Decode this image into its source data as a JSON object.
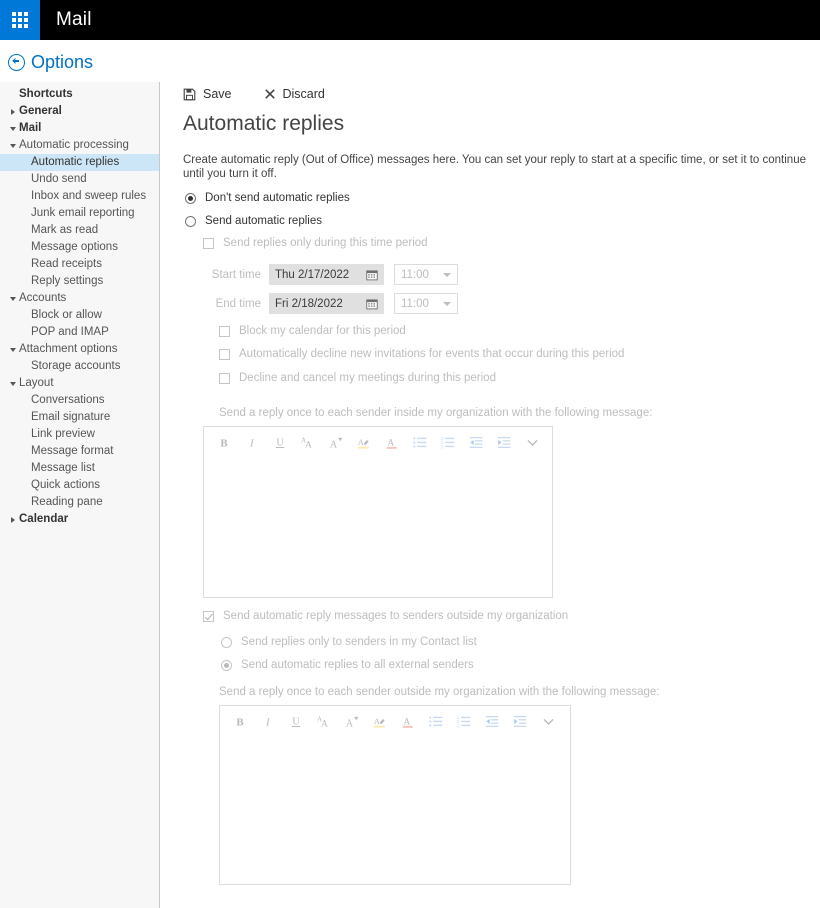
{
  "suite": {
    "app_launcher_icon": "waffle-grid-icon",
    "title": "Mail"
  },
  "options_header": {
    "back_icon": "back-circle-arrow-icon",
    "label": "Options"
  },
  "sidebar": {
    "items": [
      {
        "label": "Shortcuts",
        "level": 0,
        "twisty": "none",
        "selected": false,
        "bold": true
      },
      {
        "label": "General",
        "level": 0,
        "twisty": "closed",
        "selected": false,
        "bold": true
      },
      {
        "label": "Mail",
        "level": 0,
        "twisty": "open",
        "selected": false,
        "bold": true
      },
      {
        "label": "Automatic processing",
        "level": 1,
        "twisty": "open",
        "selected": false,
        "bold": false
      },
      {
        "label": "Automatic replies",
        "level": 2,
        "twisty": "none",
        "selected": true,
        "bold": false
      },
      {
        "label": "Undo send",
        "level": 2,
        "twisty": "none",
        "selected": false,
        "bold": false
      },
      {
        "label": "Inbox and sweep rules",
        "level": 2,
        "twisty": "none",
        "selected": false,
        "bold": false
      },
      {
        "label": "Junk email reporting",
        "level": 2,
        "twisty": "none",
        "selected": false,
        "bold": false
      },
      {
        "label": "Mark as read",
        "level": 2,
        "twisty": "none",
        "selected": false,
        "bold": false
      },
      {
        "label": "Message options",
        "level": 2,
        "twisty": "none",
        "selected": false,
        "bold": false
      },
      {
        "label": "Read receipts",
        "level": 2,
        "twisty": "none",
        "selected": false,
        "bold": false
      },
      {
        "label": "Reply settings",
        "level": 2,
        "twisty": "none",
        "selected": false,
        "bold": false
      },
      {
        "label": "Accounts",
        "level": 1,
        "twisty": "open",
        "selected": false,
        "bold": false
      },
      {
        "label": "Block or allow",
        "level": 2,
        "twisty": "none",
        "selected": false,
        "bold": false
      },
      {
        "label": "POP and IMAP",
        "level": 2,
        "twisty": "none",
        "selected": false,
        "bold": false
      },
      {
        "label": "Attachment options",
        "level": 1,
        "twisty": "open",
        "selected": false,
        "bold": false
      },
      {
        "label": "Storage accounts",
        "level": 2,
        "twisty": "none",
        "selected": false,
        "bold": false
      },
      {
        "label": "Layout",
        "level": 1,
        "twisty": "open",
        "selected": false,
        "bold": false
      },
      {
        "label": "Conversations",
        "level": 2,
        "twisty": "none",
        "selected": false,
        "bold": false
      },
      {
        "label": "Email signature",
        "level": 2,
        "twisty": "none",
        "selected": false,
        "bold": false
      },
      {
        "label": "Link preview",
        "level": 2,
        "twisty": "none",
        "selected": false,
        "bold": false
      },
      {
        "label": "Message format",
        "level": 2,
        "twisty": "none",
        "selected": false,
        "bold": false
      },
      {
        "label": "Message list",
        "level": 2,
        "twisty": "none",
        "selected": false,
        "bold": false
      },
      {
        "label": "Quick actions",
        "level": 2,
        "twisty": "none",
        "selected": false,
        "bold": false
      },
      {
        "label": "Reading pane",
        "level": 2,
        "twisty": "none",
        "selected": false,
        "bold": false
      },
      {
        "label": "Calendar",
        "level": 0,
        "twisty": "closed",
        "selected": false,
        "bold": true
      }
    ]
  },
  "commandbar": {
    "save_label": "Save",
    "save_icon": "save-disk-icon",
    "discard_label": "Discard",
    "discard_icon": "x-close-icon"
  },
  "page": {
    "title": "Automatic replies",
    "description": "Create automatic reply (Out of Office) messages here. You can set your reply to start at a specific time, or set it to continue until you turn it off."
  },
  "mode": {
    "dont_send_label": "Don't send automatic replies",
    "dont_send_selected": true,
    "send_label": "Send automatic replies",
    "send_selected": false
  },
  "time_period": {
    "enabled_label": "Send replies only during this time period",
    "enabled_checked": false,
    "start_label": "Start time",
    "start_date": "Thu 2/17/2022",
    "start_time": "11:00",
    "end_label": "End time",
    "end_date": "Fri 2/18/2022",
    "end_time": "11:00",
    "calendar_icon": "calendar-icon",
    "dropdown_icon": "chevron-down-icon",
    "block_calendar_label": "Block my calendar for this period",
    "block_calendar_checked": false,
    "decline_invites_label": "Automatically decline new invitations for events that occur during this period",
    "decline_invites_checked": false,
    "cancel_meetings_label": "Decline and cancel my meetings during this period",
    "cancel_meetings_checked": false
  },
  "inside_org": {
    "message_label": "Send a reply once to each sender inside my organization with the following message:",
    "body_text": ""
  },
  "outside_org": {
    "enable_label": "Send automatic reply messages to senders outside my organization",
    "enable_checked": true,
    "contacts_only_label": "Send replies only to senders in my Contact list",
    "contacts_only_selected": false,
    "all_external_label": "Send automatic replies to all external senders",
    "all_external_selected": true,
    "message_label": "Send a reply once to each sender outside my organization with the following message:",
    "body_text": ""
  },
  "editor_toolbar": {
    "tools": [
      {
        "name": "bold-icon",
        "glyph": "B"
      },
      {
        "name": "italic-icon",
        "glyph": "I"
      },
      {
        "name": "underline-icon",
        "glyph": "U"
      },
      {
        "name": "font-size-grow-icon",
        "glyph": "AA"
      },
      {
        "name": "font-size-shrink-icon",
        "glyph": "A"
      },
      {
        "name": "highlight-color-icon",
        "glyph": "A"
      },
      {
        "name": "font-color-icon",
        "glyph": "A"
      },
      {
        "name": "bulleted-list-icon",
        "glyph": "list"
      },
      {
        "name": "numbered-list-icon",
        "glyph": "list"
      },
      {
        "name": "decrease-indent-icon",
        "glyph": "indent"
      },
      {
        "name": "increase-indent-icon",
        "glyph": "indent"
      },
      {
        "name": "more-options-icon",
        "glyph": "chevron"
      }
    ]
  },
  "colors": {
    "accent": "#0078d7",
    "link": "#0072c6",
    "selected_nav": "#cde6f7",
    "sidebar_bg": "#f7f7f7",
    "highlight_yellow": "#ffd24d",
    "font_red": "#e8776f"
  }
}
